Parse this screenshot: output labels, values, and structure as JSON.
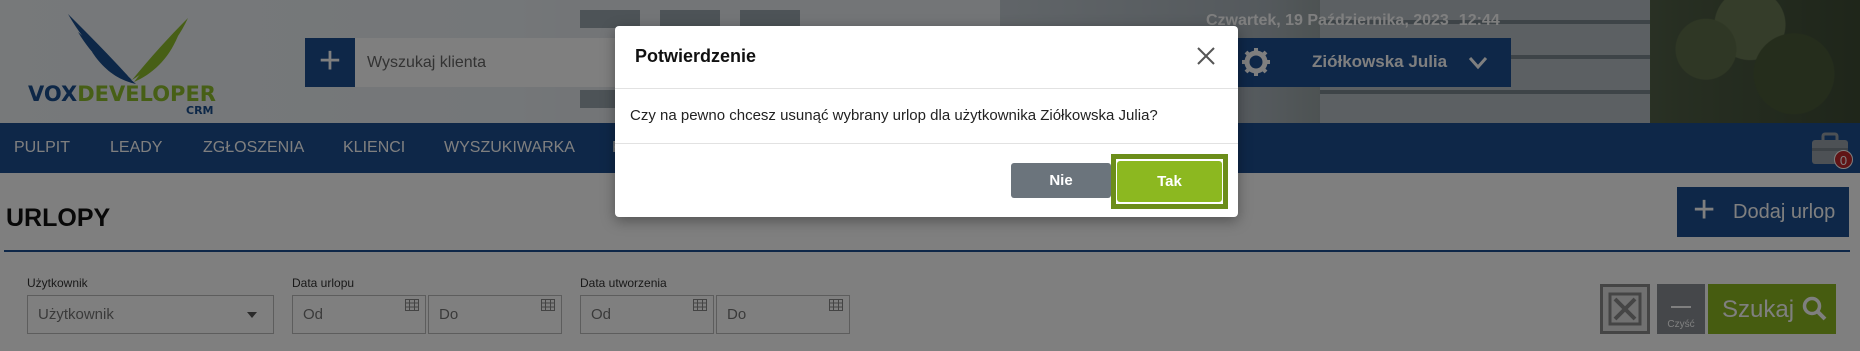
{
  "header": {
    "logo_text_1": "VOX",
    "logo_text_2": "DEVELOPER",
    "logo_sub": "CRM",
    "search_placeholder": "Wyszukaj klienta",
    "add_icon": "plus-icon",
    "date": "Czwartek, 19 Października, 2023",
    "time": "12:44",
    "user_name": "Ziółkowska Julia"
  },
  "nav": {
    "items": [
      "PULPIT",
      "LEADY",
      "ZGŁOSZENIA",
      "KLIENCI",
      "WYSZUKIWARKA",
      "R"
    ],
    "briefcase_badge": "0"
  },
  "page": {
    "title": "URLOPY",
    "add_button": "Dodaj urlop"
  },
  "filters": {
    "user_label": "Użytkownik",
    "user_placeholder": "Użytkownik",
    "leave_date_label": "Data urlopu",
    "created_date_label": "Data utworzenia",
    "from_placeholder": "Od",
    "to_placeholder": "Do",
    "clear_label": "Czyść",
    "search_label": "Szukaj"
  },
  "modal": {
    "title": "Potwierdzenie",
    "message": "Czy na pewno chcesz usunąć wybrany urlop dla użytkownika Ziółkowska Julia?",
    "no_label": "Nie",
    "yes_label": "Tak"
  },
  "colors": {
    "brand_blue": "#1d4f91",
    "accent_green": "#8cb820",
    "badge_red": "#c0282d"
  }
}
